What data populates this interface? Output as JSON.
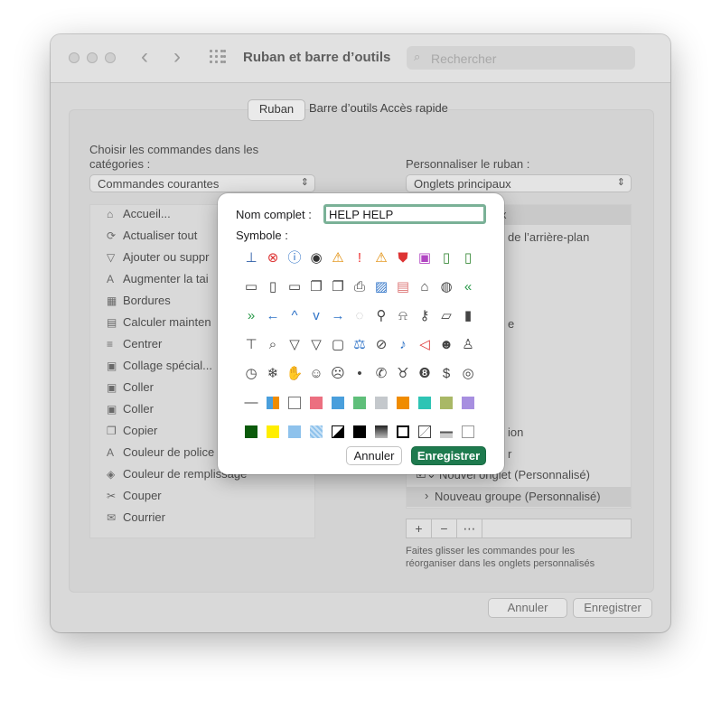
{
  "window": {
    "title": "Ruban et barre d’outils",
    "search_placeholder": "Rechercher",
    "tabs": [
      "Ruban",
      "Barre d’outils Accès rapide"
    ],
    "footer": {
      "cancel_label": "Annuler",
      "save_label": "Enregistrer"
    }
  },
  "left": {
    "choose_label": "Choisir les commandes dans les catégories :",
    "dropdown_value": "Commandes courantes",
    "commands": [
      {
        "label": "Accueil...",
        "icon": "home-icon"
      },
      {
        "label": "Actualiser tout",
        "icon": "refresh-all-icon"
      },
      {
        "label": "Ajouter ou suppr",
        "icon": "filter-icon"
      },
      {
        "label": "Augmenter la tai",
        "icon": "increase-font-icon"
      },
      {
        "label": "Bordures",
        "icon": "borders-icon"
      },
      {
        "label": "Calculer mainten",
        "icon": "calculator-icon"
      },
      {
        "label": "Centrer",
        "icon": "center-align-icon"
      },
      {
        "label": "Collage spécial...",
        "icon": "paste-special-icon"
      },
      {
        "label": "Coller",
        "icon": "paste-icon"
      },
      {
        "label": "Coller",
        "icon": "paste-icon"
      },
      {
        "label": "Copier",
        "icon": "copy-icon"
      },
      {
        "label": "Couleur de police",
        "icon": "font-color-icon"
      },
      {
        "label": "Couleur de remplissage",
        "icon": "fill-color-icon"
      },
      {
        "label": "Couper",
        "icon": "scissors-icon"
      },
      {
        "label": "Courrier",
        "icon": "mail-icon"
      }
    ]
  },
  "right": {
    "customize_label": "Personnaliser le ruban :",
    "dropdown_value": "Onglets principaux",
    "tree_rows": [
      {
        "label": "x"
      },
      {
        "label": "de l’arrière-plan"
      },
      {
        "label": "e"
      },
      {
        "label": "ion"
      },
      {
        "label": "r"
      },
      {
        "label": "Nouvel onglet (Personnalisé)"
      },
      {
        "label": "Nouveau groupe (Personnalisé)"
      }
    ],
    "toolbar": [
      "+",
      "−",
      "⋯"
    ],
    "hint": "Faites glisser les commandes pour les réorganiser dans les onglets personnalisés"
  },
  "modal": {
    "name_label": "Nom complet :",
    "name_value": "HELP HELP",
    "symbol_label": "Symbole :",
    "cancel_label": "Annuler",
    "save_label": "Enregistrer",
    "symbols": [
      [
        "org-chart-icon",
        "cancel-circle-icon",
        "info-icon",
        "target-icon",
        "warning-icon",
        "exclamation-icon",
        "warning-icon",
        "shield-icon",
        "save-disk-icon",
        "document-arrow-icon",
        "document-refresh-icon"
      ],
      [
        "folder-icon",
        "document-icon",
        "folder-open-icon",
        "window-stack-icon",
        "window-stack-icon",
        "printer-icon",
        "image-icon",
        "document-signed-icon",
        "house-icon",
        "palette-icon",
        "double-arrow-left-icon"
      ],
      [
        "double-arrow-right-icon",
        "arrow-left-icon",
        "chevron-up-icon",
        "chevron-down-icon",
        "arrow-right-icon",
        "back-circle-icon",
        "pin-icon",
        "lock-icon",
        "key-icon",
        "scroll-icon",
        "bookmark-icon"
      ],
      [
        "presentation-icon",
        "magnifier-icon",
        "funnel-icon",
        "funnel-icon",
        "badge-person-icon",
        "scales-icon",
        "no-entry-icon",
        "microphone-icon",
        "mute-icon",
        "person-group-icon",
        "person-icon"
      ],
      [
        "clock-icon",
        "snowflake-icon",
        "hand-icon",
        "smile-icon",
        "frown-icon",
        "calculator-icon",
        "phone-icon",
        "piggy-bank-icon",
        "eight-ball-icon",
        "dollar-people-icon",
        "eye-icon"
      ],
      [
        "dash-icon",
        "grid-color-icon",
        "swatch-white",
        "swatch-pink",
        "swatch-blue",
        "swatch-green",
        "swatch-gray",
        "swatch-orange",
        "swatch-teal",
        "swatch-olive",
        "swatch-purple"
      ],
      [
        "swatch-darkgreen",
        "swatch-yellow",
        "swatch-lightblue",
        "swatch-checkblue",
        "swatch-diagonal",
        "swatch-black",
        "swatch-gradient",
        "swatch-frame",
        "swatch-slash",
        "swatch-bars",
        "swatch-empty"
      ]
    ]
  },
  "colors": {
    "accent": "#1e7a4e",
    "focus_ring": "#7ab197",
    "swatches": {
      "swatch-white": "#ffffff",
      "swatch-pink": "#ec6f80",
      "swatch-blue": "#4a9fdc",
      "swatch-green": "#5fbf7a",
      "swatch-gray": "#c4c8cc",
      "swatch-orange": "#f08c00",
      "swatch-teal": "#2ec4b4",
      "swatch-olive": "#a9b866",
      "swatch-purple": "#a78fe0",
      "swatch-darkgreen": "#0b5a0b",
      "swatch-yellow": "#ffee00",
      "swatch-lightblue": "#8ec2ec",
      "swatch-checkblue": "#8ec2ec",
      "swatch-black": "#000000"
    }
  }
}
